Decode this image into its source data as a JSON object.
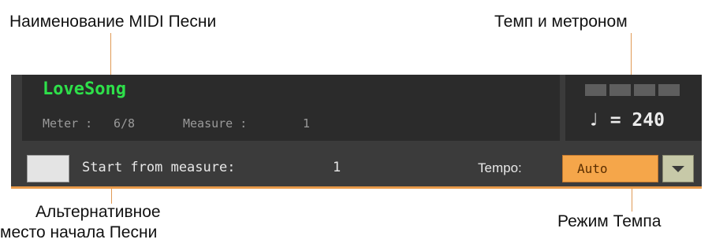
{
  "callouts": {
    "song_name": "Наименование MIDI Песни",
    "tempo_metronome": "Темп и метроном",
    "alt_start_line1": "Альтернативное",
    "alt_start_line2": "место начала Песни",
    "tempo_mode": "Режим Темпа"
  },
  "song": {
    "name": "LoveSong",
    "meter_label": "Meter :",
    "meter_value": "6/8",
    "measure_label": "Measure :",
    "measure_value": "1"
  },
  "tempo": {
    "display": "♩ = 240",
    "beats": 4,
    "label": "Tempo:",
    "mode_selected": "Auto"
  },
  "start": {
    "checked": false,
    "label": "Start from measure:",
    "value": "1"
  },
  "colors": {
    "accent": "#f5a64a",
    "song_name": "#2ee04a",
    "panel": "#3b3b3b"
  },
  "icons": {
    "dropdown": "chevron-down-icon"
  }
}
